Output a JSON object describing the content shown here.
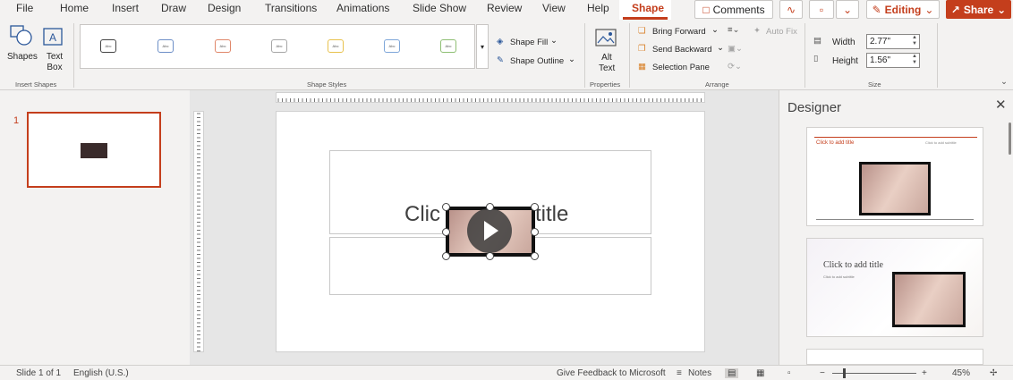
{
  "menu": {
    "tabs": [
      "File",
      "Home",
      "Insert",
      "Draw",
      "Design",
      "Transitions",
      "Animations",
      "Slide Show",
      "Review",
      "View",
      "Help",
      "Shape"
    ],
    "active_tab": "Shape",
    "comments_label": "Comments",
    "editing_label": "Editing",
    "share_label": "Share"
  },
  "ribbon": {
    "insert_shapes": {
      "shapes_label": "Shapes",
      "textbox_label": "Text Box",
      "group_label": "Insert Shapes"
    },
    "shape_styles": {
      "group_label": "Shape Styles",
      "fill_label": "Shape Fill",
      "outline_label": "Shape Outline",
      "thumb_text": "Abc"
    },
    "properties": {
      "alt_text_label": "Alt Text",
      "group_label": "Properties"
    },
    "arrange": {
      "bring_forward": "Bring Forward",
      "send_backward": "Send Backward",
      "selection_pane": "Selection Pane",
      "auto_fix": "Auto Fix",
      "group_label": "Arrange"
    },
    "size": {
      "width_label": "Width",
      "width_value": "2.77\"",
      "height_label": "Height",
      "height_value": "1.56\"",
      "group_label": "Size"
    }
  },
  "slides": {
    "current_number": "1"
  },
  "slide": {
    "title_placeholder_visible": "Clic",
    "title_placeholder_end": "title"
  },
  "designer": {
    "title": "Designer",
    "card1_title": "Click to add title",
    "card1_subtitle": "Click to add subtitle",
    "card2_title": "Click to add title",
    "card2_subtitle": "Click to add subtitle"
  },
  "status": {
    "slide_info": "Slide 1 of 1",
    "language": "English (U.S.)",
    "feedback": "Give Feedback to Microsoft",
    "notes": "Notes",
    "zoom": "45%"
  },
  "colors": {
    "accent": "#c43e1c"
  }
}
